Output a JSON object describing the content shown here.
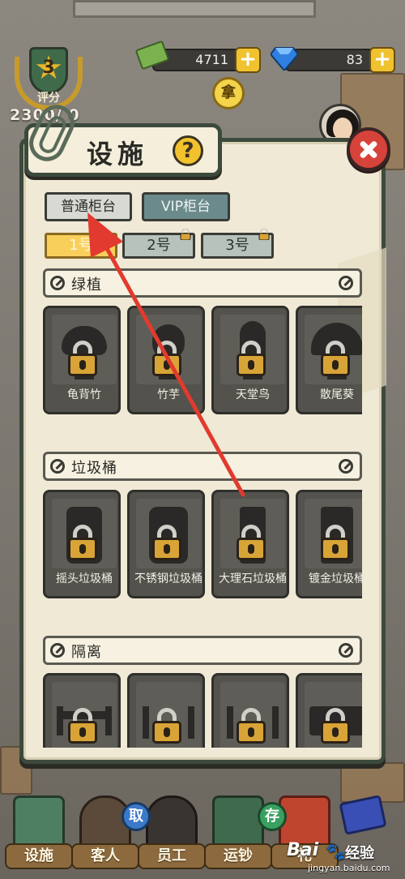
{
  "hud": {
    "rating_label": "评分",
    "rating_level": "3",
    "score_text": "2300/   0",
    "cash": "4711",
    "gems": "83",
    "plus_symbol": "+",
    "take_label": "拿"
  },
  "dialog": {
    "title": "设施",
    "help_symbol": "?",
    "tabs": [
      {
        "label": "普通柜台",
        "active": true
      },
      {
        "label": "VIP柜台",
        "active": false
      }
    ],
    "sub_tabs": [
      {
        "label": "1号",
        "locked": false,
        "active": true
      },
      {
        "label": "2号",
        "locked": true,
        "active": false
      },
      {
        "label": "3号",
        "locked": true,
        "active": false
      }
    ],
    "sections": [
      {
        "title": "绿植",
        "items": [
          "龟背竹",
          "竹芋",
          "天堂鸟",
          "散尾葵"
        ]
      },
      {
        "title": "垃圾桶",
        "items": [
          "摇头垃圾桶",
          "不锈钢垃圾桶",
          "大理石垃圾桶",
          "镀金垃圾桶"
        ]
      },
      {
        "title": "隔离",
        "items": [
          "",
          "",
          "",
          ""
        ]
      }
    ]
  },
  "bottom_nav": {
    "items": [
      "设施",
      "客人",
      "员工",
      "运钞",
      "礼"
    ],
    "bubbles": [
      "取",
      "存"
    ]
  },
  "watermark": {
    "text": "Bai",
    "text2": "经验",
    "url": "jingyan.baidu.com"
  },
  "colors": {
    "annotation_arrow": "#e23a2e",
    "lock_gold": "#d9a437",
    "close_red": "#d6433a",
    "active_subtab": "#f9cf5c",
    "vip_tab": "#6b8a8c"
  }
}
